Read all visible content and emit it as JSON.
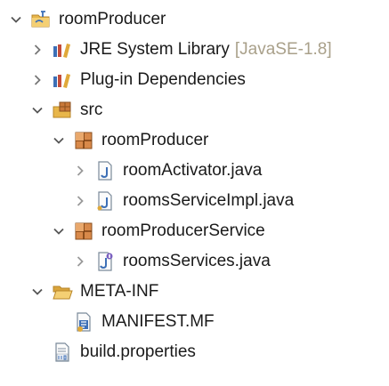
{
  "tree": {
    "project": {
      "label": "roomProducer",
      "icon": "plugin-project-icon",
      "expanded": true
    },
    "jre": {
      "label": "JRE System Library",
      "decoration": "[JavaSE-1.8]",
      "icon": "library-icon",
      "expanded": false
    },
    "plugin_deps": {
      "label": "Plug-in Dependencies",
      "icon": "library-icon",
      "expanded": false
    },
    "src": {
      "label": "src",
      "icon": "source-folder-icon",
      "expanded": true
    },
    "pkg_producer": {
      "label": "roomProducer",
      "icon": "package-icon",
      "expanded": true
    },
    "room_activator": {
      "label": "roomActivator.java",
      "icon": "java-file-icon",
      "expanded": false
    },
    "rooms_service_impl": {
      "label": "roomsServiceImpl.java",
      "icon": "java-file-icon",
      "expanded": false
    },
    "pkg_service": {
      "label": "roomProducerService",
      "icon": "package-icon",
      "expanded": true
    },
    "rooms_services": {
      "label": "roomsServices.java",
      "icon": "java-interface-file-icon",
      "expanded": false
    },
    "meta_inf": {
      "label": "META-INF",
      "icon": "folder-icon",
      "expanded": true
    },
    "manifest": {
      "label": "MANIFEST.MF",
      "icon": "manifest-file-icon"
    },
    "build_props": {
      "label": "build.properties",
      "icon": "properties-file-icon"
    }
  },
  "colors": {
    "text": "#1a1a1a",
    "decoration": "#a9a08a",
    "chevron": "#555555",
    "folder": "#e8b64a",
    "java_blue": "#3d6fb6"
  }
}
